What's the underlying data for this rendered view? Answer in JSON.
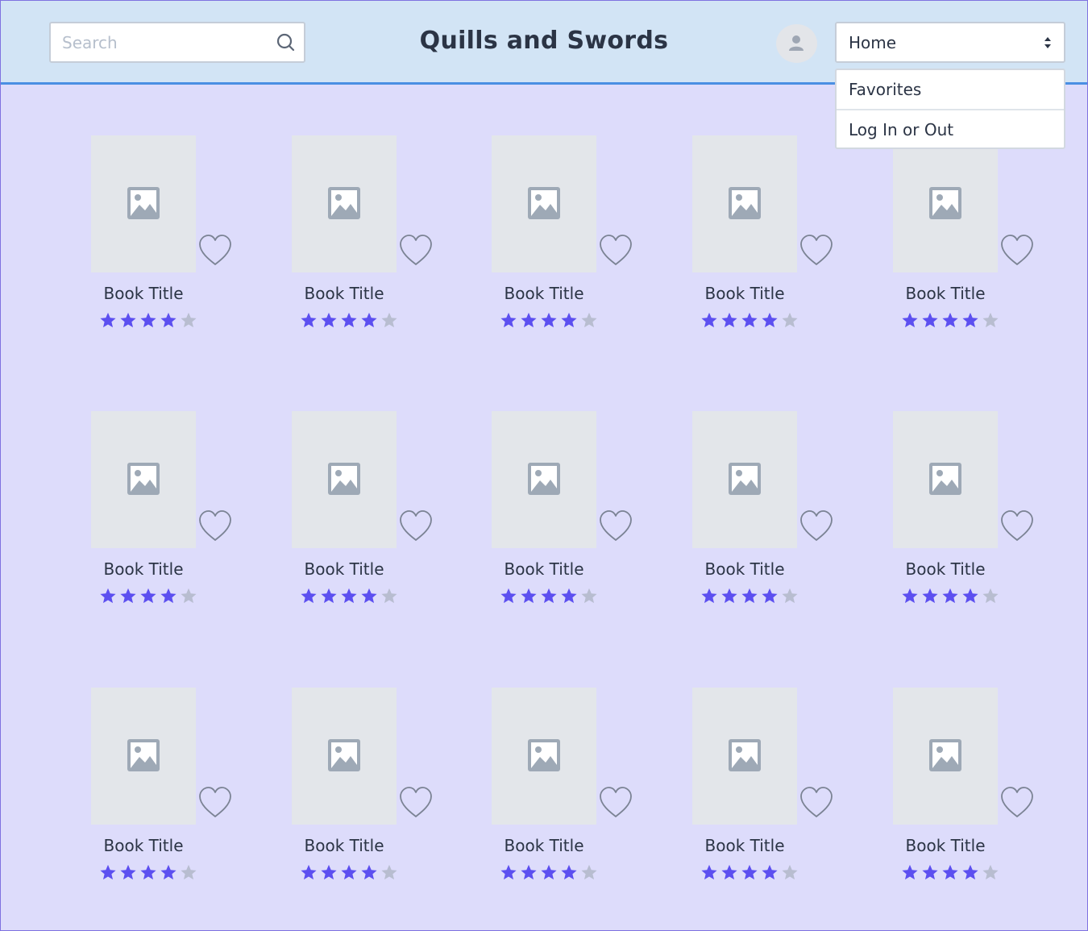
{
  "header": {
    "search_placeholder": "Search",
    "app_title": "Quills and Swords",
    "nav_select": {
      "value": "Home",
      "options": [
        "Favorites",
        "Log In or Out"
      ]
    }
  },
  "books": [
    {
      "title": "Book Title",
      "rating": 4,
      "favorite": false
    },
    {
      "title": "Book Title",
      "rating": 4,
      "favorite": false
    },
    {
      "title": "Book Title",
      "rating": 4,
      "favorite": false
    },
    {
      "title": "Book Title",
      "rating": 4,
      "favorite": false
    },
    {
      "title": "Book Title",
      "rating": 4,
      "favorite": false
    },
    {
      "title": "Book Title",
      "rating": 4,
      "favorite": false
    },
    {
      "title": "Book Title",
      "rating": 4,
      "favorite": false
    },
    {
      "title": "Book Title",
      "rating": 4,
      "favorite": false
    },
    {
      "title": "Book Title",
      "rating": 4,
      "favorite": false
    },
    {
      "title": "Book Title",
      "rating": 4,
      "favorite": false
    },
    {
      "title": "Book Title",
      "rating": 4,
      "favorite": false
    },
    {
      "title": "Book Title",
      "rating": 4,
      "favorite": false
    },
    {
      "title": "Book Title",
      "rating": 4,
      "favorite": false
    },
    {
      "title": "Book Title",
      "rating": 4,
      "favorite": false
    },
    {
      "title": "Book Title",
      "rating": 4,
      "favorite": false
    }
  ],
  "rating_max": 5,
  "colors": {
    "star_filled": "#5c4ff0",
    "star_empty": "#b8bdd0",
    "heart_outline": "#7b8394",
    "page_background": "#dddcfb",
    "header_background": "#d2e4f5",
    "header_border": "#4a8fe3"
  },
  "icons": {
    "search": "search-icon",
    "avatar": "user-icon",
    "select": "sort-arrows-icon",
    "cover": "image-placeholder-icon",
    "favorite": "heart-outline-icon",
    "rating": "star-icon"
  }
}
